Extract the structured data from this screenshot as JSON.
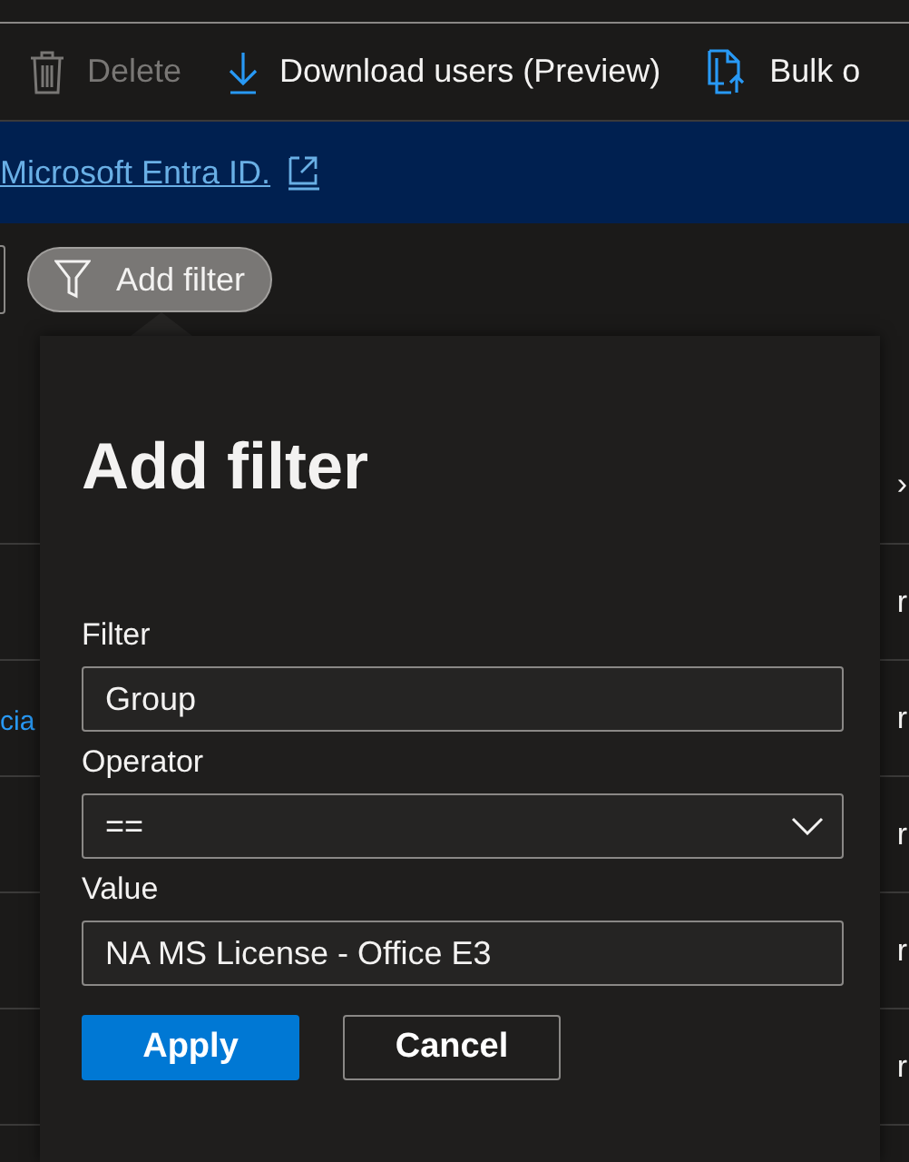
{
  "toolbar": [
    {
      "kind": "delete",
      "label": "Delete",
      "disabled": true
    },
    {
      "kind": "download",
      "label": "Download users (Preview)",
      "disabled": false
    },
    {
      "kind": "bulk",
      "label": "Bulk o",
      "disabled": false
    }
  ],
  "banner": {
    "link": "Microsoft Entra ID."
  },
  "filter_button": {
    "label": "Add filter"
  },
  "background_table": {
    "header_fragment": "›",
    "rows": [
      {
        "left": "",
        "right": "r"
      },
      {
        "left": "cia",
        "right": "r"
      },
      {
        "left": "",
        "right": "r"
      },
      {
        "left": "",
        "right": "r"
      },
      {
        "left": "",
        "right": "r"
      }
    ]
  },
  "callout": {
    "title": "Add filter",
    "fields": [
      {
        "kind": "text",
        "label": "Filter",
        "value": "Group"
      },
      {
        "kind": "dropdown",
        "label": "Operator",
        "value": "=="
      },
      {
        "kind": "text",
        "label": "Value",
        "value": "NA MS License - Office E3"
      }
    ],
    "buttons": [
      {
        "label": "Apply",
        "primary": true
      },
      {
        "label": "Cancel",
        "primary": false
      }
    ]
  }
}
